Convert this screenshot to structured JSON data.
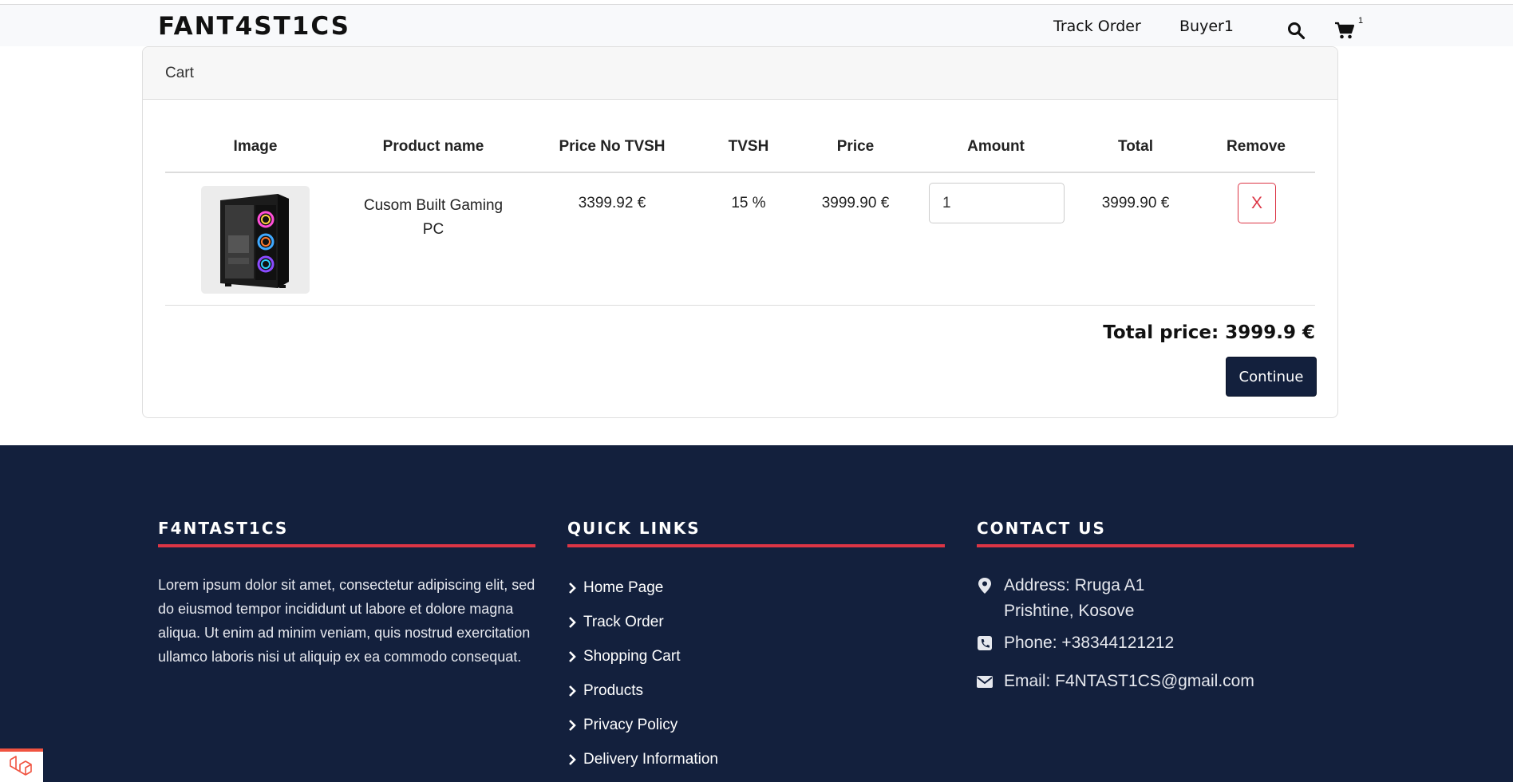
{
  "nav": {
    "brand": "FANT4ST1CS",
    "links": [
      "Track Order",
      "Buyer1"
    ],
    "cart_count": "1",
    "icons": [
      "search-icon",
      "cart-icon"
    ]
  },
  "cart": {
    "header": "Cart",
    "columns": [
      "Image",
      "Product name",
      "Price No TVSH",
      "TVSH",
      "Price",
      "Amount",
      "Total",
      "Remove"
    ],
    "items": [
      {
        "image_icon": "gaming-pc-case-image",
        "name_line1": "Cusom Built Gaming",
        "name_line2": "PC",
        "price_no_tvsh": "3399.92 €",
        "tvsh": "15 %",
        "price": "3999.90 €",
        "amount": "1",
        "total": "3999.90 €",
        "remove_label": "X"
      }
    ],
    "total_price": "Total price: 3999.9 €",
    "continue_label": "Continue"
  },
  "footer": {
    "about": {
      "title": "F4NTAST1CS",
      "text": "Lorem ipsum dolor sit amet, consectetur adipiscing elit, sed do eiusmod tempor incididunt ut labore et dolore magna aliqua. Ut enim ad minim veniam, quis nostrud exercitation ullamco laboris nisi ut aliquip ex ea commodo consequat."
    },
    "quick_links": {
      "title": "QUICK LINKS",
      "items": [
        "Home Page",
        "Track Order",
        "Shopping Cart",
        "Products",
        "Privacy Policy",
        "Delivery Information"
      ]
    },
    "contact": {
      "title": "CONTACT US",
      "address_line1": "Address: Rruga A1",
      "address_line2": "Prishtine, Kosove",
      "phone": "Phone: +38344121212",
      "email": "Email: F4NTAST1CS@gmail.com"
    }
  },
  "colors": {
    "footer_bg": "#13203d",
    "accent_red": "#dc3545",
    "button_navy": "#13203d"
  }
}
